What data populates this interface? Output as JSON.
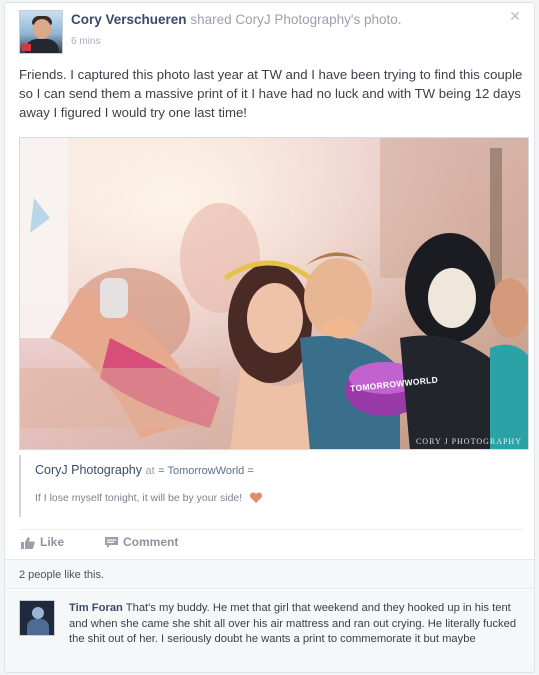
{
  "post": {
    "author": "Cory Verschueren",
    "shared_text": "shared",
    "shared_link": "CoryJ Photography's photo.",
    "time": "6 mins",
    "text": "Friends. I captured this photo last year at TW and I have been trying to find this couple so I can send them a massive print of it I have had no luck and with TW being 12 days away I figured I would try one last time!"
  },
  "photo": {
    "watermark": "CORY J PHOTOGRAPHY",
    "hat_text": "TOMORROWWORLD"
  },
  "shared_link_box": {
    "page": "CoryJ Photography",
    "at": "at",
    "location": "= TomorrowWorld =",
    "caption": "If I lose myself tonight, it will be by your side!"
  },
  "actions": {
    "like": "Like",
    "comment": "Comment"
  },
  "likes": {
    "text": "2 people like this."
  },
  "comment": {
    "author": "Tim Foran",
    "text": "That's my buddy. He met that girl that weekend and they hooked up in his tent and when she came she shit all over his air mattress and ran out crying. He literally fucked the shit out of her. I seriously doubt he wants a print to commemorate it but maybe"
  },
  "colors": {
    "name_link": "#3b4a6b",
    "muted": "#9aa1ad",
    "heart": "#e58a6a"
  },
  "icons": {
    "close": "close-icon",
    "like": "thumbs-up-icon",
    "comment": "comment-icon",
    "heart": "heart-icon"
  }
}
